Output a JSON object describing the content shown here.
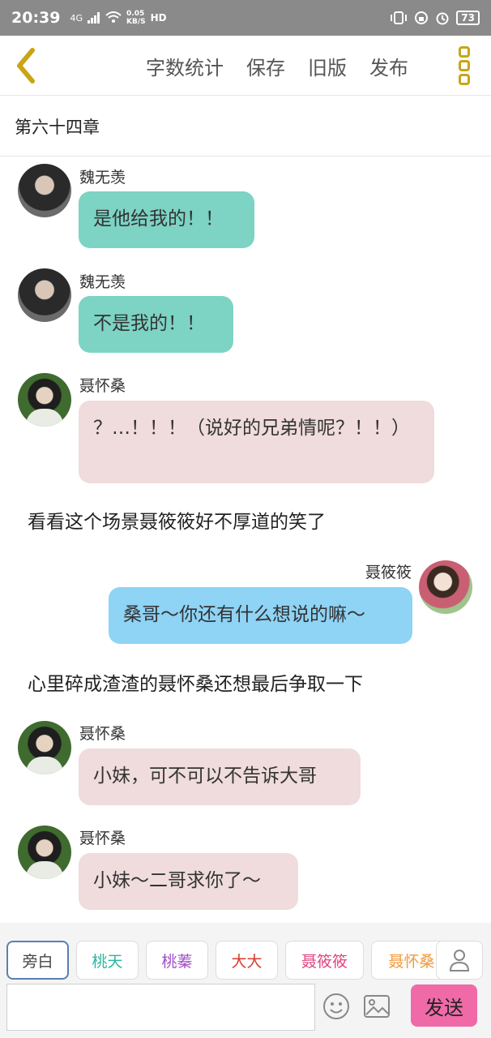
{
  "status_bar": {
    "time": "20:39",
    "network": "4G",
    "speed_value": "0.05",
    "speed_unit": "KB/S",
    "hd": "HD",
    "battery": "73"
  },
  "nav": {
    "actions": [
      "字数统计",
      "保存",
      "旧版",
      "发布"
    ]
  },
  "chapter": {
    "title": "第六十四章"
  },
  "messages": [
    {
      "sender": "魏无羡",
      "text": "是他给我的！！"
    },
    {
      "sender": "魏无羡",
      "text": "不是我的！！"
    },
    {
      "sender": "聂怀桑",
      "text": "？…！！！（说好的兄弟情呢？！！）"
    },
    {
      "narration": "看看这个场景聂筱筱好不厚道的笑了"
    },
    {
      "sender": "聂筱筱",
      "text": "桑哥～你还有什么想说的嘛～"
    },
    {
      "narration": "心里碎成渣渣的聂怀桑还想最后争取一下"
    },
    {
      "sender": "聂怀桑",
      "text": "小妹，可不可以不告诉大哥"
    },
    {
      "sender": "聂怀桑",
      "text": "小妹～二哥求你了～"
    }
  ],
  "characters": [
    {
      "label": "旁白",
      "color": "#444444"
    },
    {
      "label": "桃天",
      "color": "#2bb6a0"
    },
    {
      "label": "桃蓁",
      "color": "#a24fc7"
    },
    {
      "label": "大大",
      "color": "#d63b2f"
    },
    {
      "label": "聂筱筱",
      "color": "#e0447f"
    },
    {
      "label": "聂怀桑",
      "color": "#f09a3e"
    }
  ],
  "composer": {
    "placeholder": "",
    "send_label": "发送"
  },
  "colors": {
    "accent_yellow": "#c9a516",
    "send_pink": "#f06aa8",
    "bubble_teal": "#7dd3c4",
    "bubble_pink": "#f0dcdc",
    "bubble_blue": "#8fd3f5"
  },
  "icons": [
    "back-icon",
    "more-icon",
    "user-icon",
    "emoji-icon",
    "image-icon",
    "wifi-icon",
    "signal-icon",
    "alarm-icon"
  ]
}
